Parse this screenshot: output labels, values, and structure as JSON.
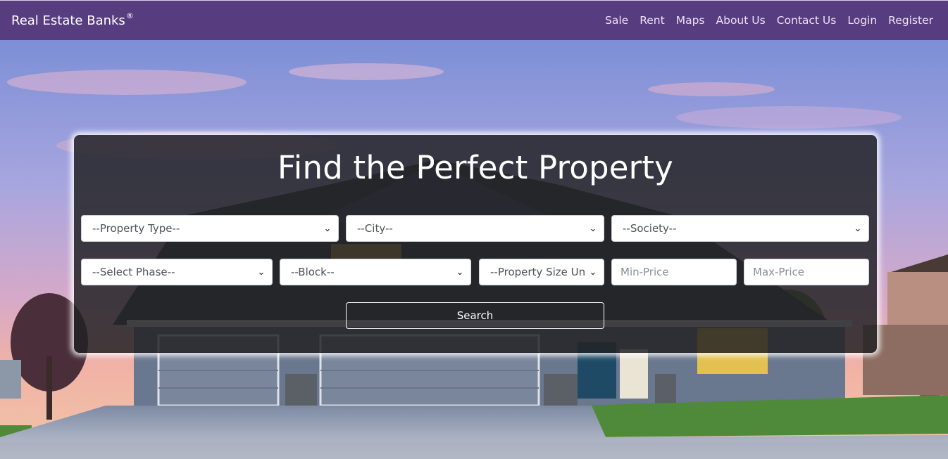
{
  "navbar": {
    "brand": "Real Estate Banks",
    "brand_mark": "®",
    "links": [
      "Sale",
      "Rent",
      "Maps",
      "About Us",
      "Contact Us",
      "Login",
      "Register"
    ]
  },
  "search": {
    "title": "Find the Perfect Property",
    "property_type": "--Property Type--",
    "city": "--City--",
    "society": "--Society--",
    "phase": "--Select Phase--",
    "block": "--Block--",
    "size_unit": "--Property Size Un",
    "min_price_placeholder": "Min-Price",
    "max_price_placeholder": "Max-Price",
    "search_label": "Search"
  },
  "icons": {
    "dropdown": "chevron-down-icon"
  },
  "colors": {
    "navbar": "#583c80",
    "panel": "#212124"
  }
}
